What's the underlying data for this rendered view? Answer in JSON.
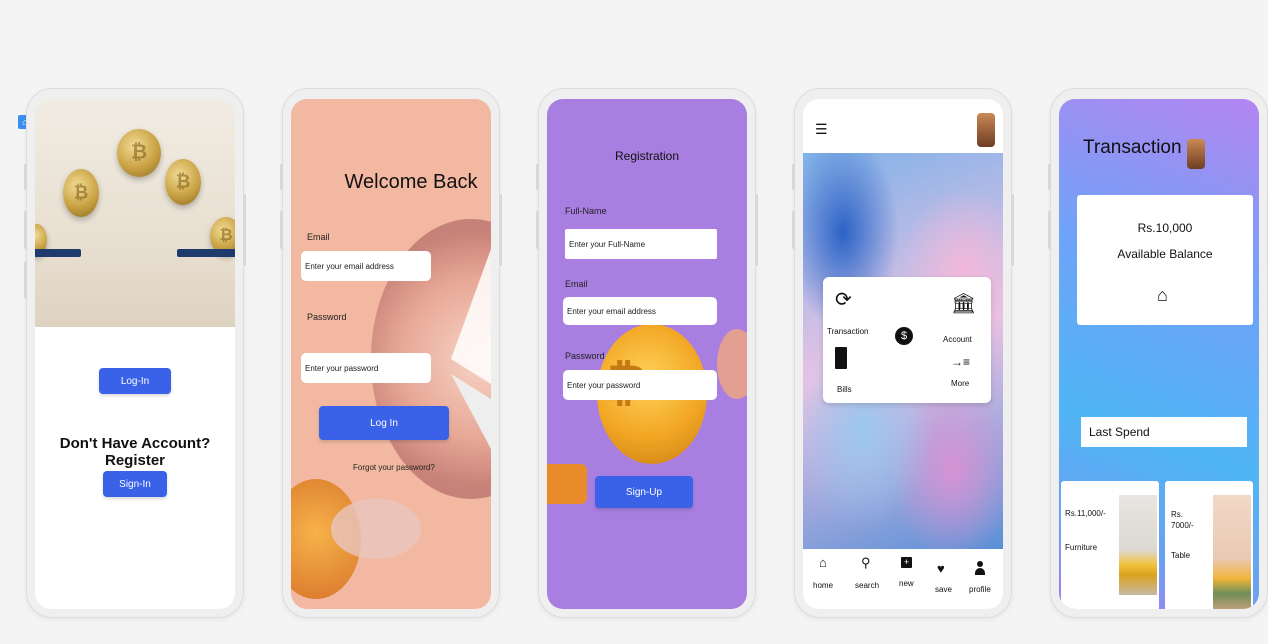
{
  "phone1": {
    "login_label": "Log-In",
    "register_text": "Don't Have Account?Register",
    "signin_label": "Sign-In"
  },
  "phone2": {
    "title": "Welcome Back",
    "email_label": "Email",
    "email_placeholder": "Enter your email address",
    "password_label": "Password",
    "password_placeholder": "Enter your password",
    "login_label": "Log In",
    "forgot_text": "Forgot your password?"
  },
  "phone3": {
    "title": "Registration",
    "fullname_label": "Full-Name",
    "fullname_placeholder": "Enter your Full-Name",
    "email_label": "Email",
    "email_placeholder": "Enter your email address",
    "password_label": "Password",
    "password_placeholder": "Enter your password",
    "signup_label": "Sign-Up"
  },
  "phone4": {
    "menu_items": {
      "transaction": "Transaction",
      "account": "Account",
      "bills": "Bills",
      "more": "More"
    },
    "nav": {
      "home": "home",
      "search": "search",
      "new": "new",
      "save": "save",
      "profile": "profile"
    }
  },
  "phone5": {
    "title": "Transaction",
    "balance_amount": "Rs.10,000",
    "balance_label": "Available Balance",
    "last_spend": "Last Spend",
    "item1_price": "Rs.11,000/-",
    "item1_name": "Furniture",
    "item2_price": "Rs. 7000/-",
    "item2_name": "Table"
  },
  "colors": {
    "button_blue": "#3a62e8",
    "peach": "#f3b8a1",
    "purple": "#a87fe0"
  }
}
